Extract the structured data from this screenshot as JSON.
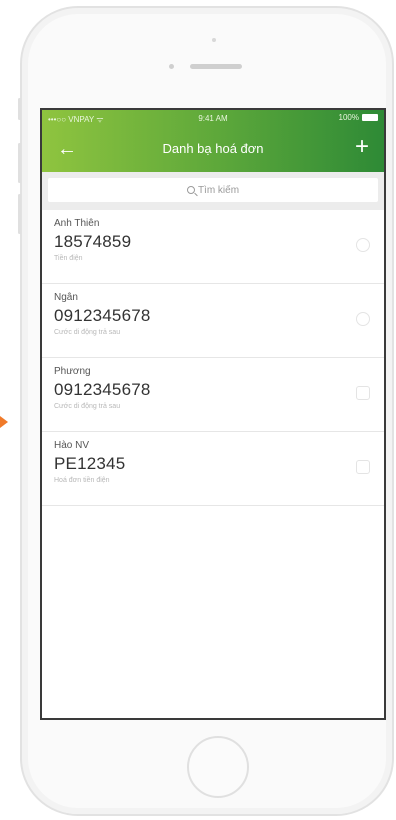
{
  "status_bar": {
    "carrier": "•••○○ VNPAY ᯤ",
    "time": "9:41 AM",
    "battery": "100%"
  },
  "nav": {
    "title": "Danh bạ hoá đơn",
    "back_icon": "arrow-left-icon",
    "add_icon": "plus-icon"
  },
  "search": {
    "placeholder": "Tìm kiếm"
  },
  "contacts": [
    {
      "name": "Anh Thiên",
      "code": "18574859",
      "service": "Tiền điện"
    },
    {
      "name": "Ngân",
      "code": "0912345678",
      "service": "Cước di động trả sau"
    },
    {
      "name": "Phương",
      "code": "0912345678",
      "service": "Cước di động trả sau"
    },
    {
      "name": "Hào NV",
      "code": "PE12345",
      "service": "Hoá đơn tiền điện"
    }
  ],
  "colors": {
    "appbar_start": "#8fc43f",
    "appbar_end": "#2e8a36",
    "marker": "#f07a2a"
  }
}
